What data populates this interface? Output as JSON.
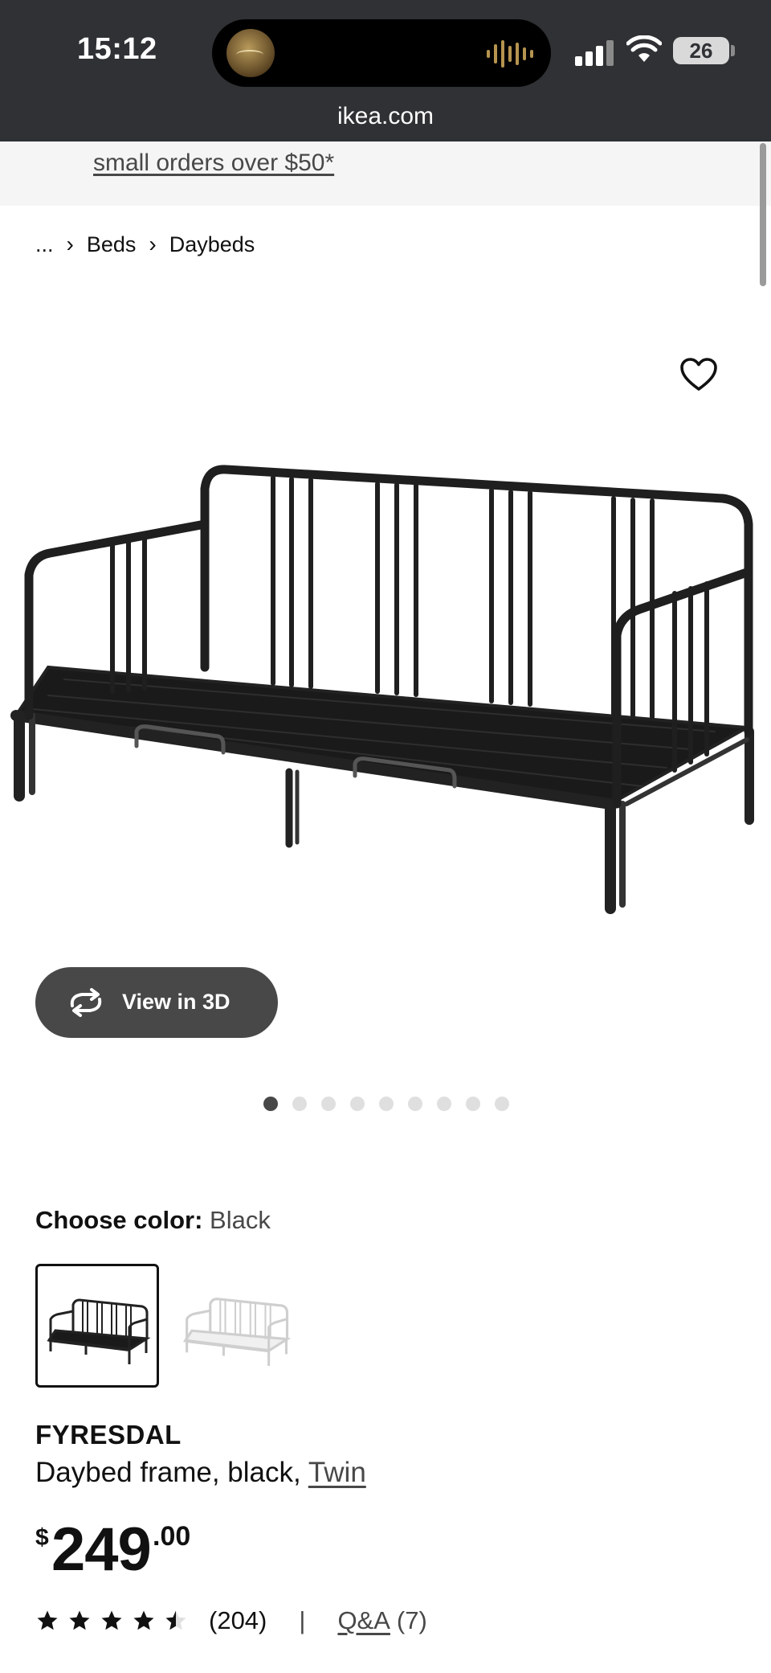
{
  "status_bar": {
    "time": "15:12",
    "battery": "26",
    "now_playing_art": "Puberty Flush album art"
  },
  "browser": {
    "url": "ikea.com"
  },
  "promo": {
    "text": "small orders over $50*"
  },
  "breadcrumb": {
    "ellipsis": "...",
    "items": [
      "Beds",
      "Daybeds"
    ]
  },
  "product": {
    "name": "FYRESDAL",
    "description_prefix": "Daybed frame, black, ",
    "size_link": "Twin",
    "price": {
      "currency": "$",
      "integer": "249",
      "decimal": ".00"
    },
    "rating": {
      "stars": 4.5,
      "count": "(204)",
      "separator": "|",
      "qa_label": "Q&A",
      "qa_count": "(7)"
    }
  },
  "media": {
    "view_3d_label": "View in 3D",
    "image_count": 9,
    "active_image": 1
  },
  "color": {
    "label": "Choose color:",
    "selected": "Black",
    "options": [
      "Black",
      "White"
    ]
  },
  "colors": {
    "dark_gray": "#484848",
    "status_bar": "#2f3134",
    "promo_bg": "#f5f5f5",
    "dot_inactive": "#dfdfdf"
  },
  "icons": [
    "heart-icon",
    "rotate-3d-icon",
    "star-icon",
    "chevron-right-icon",
    "wifi-icon",
    "signal-icon",
    "battery-icon"
  ]
}
